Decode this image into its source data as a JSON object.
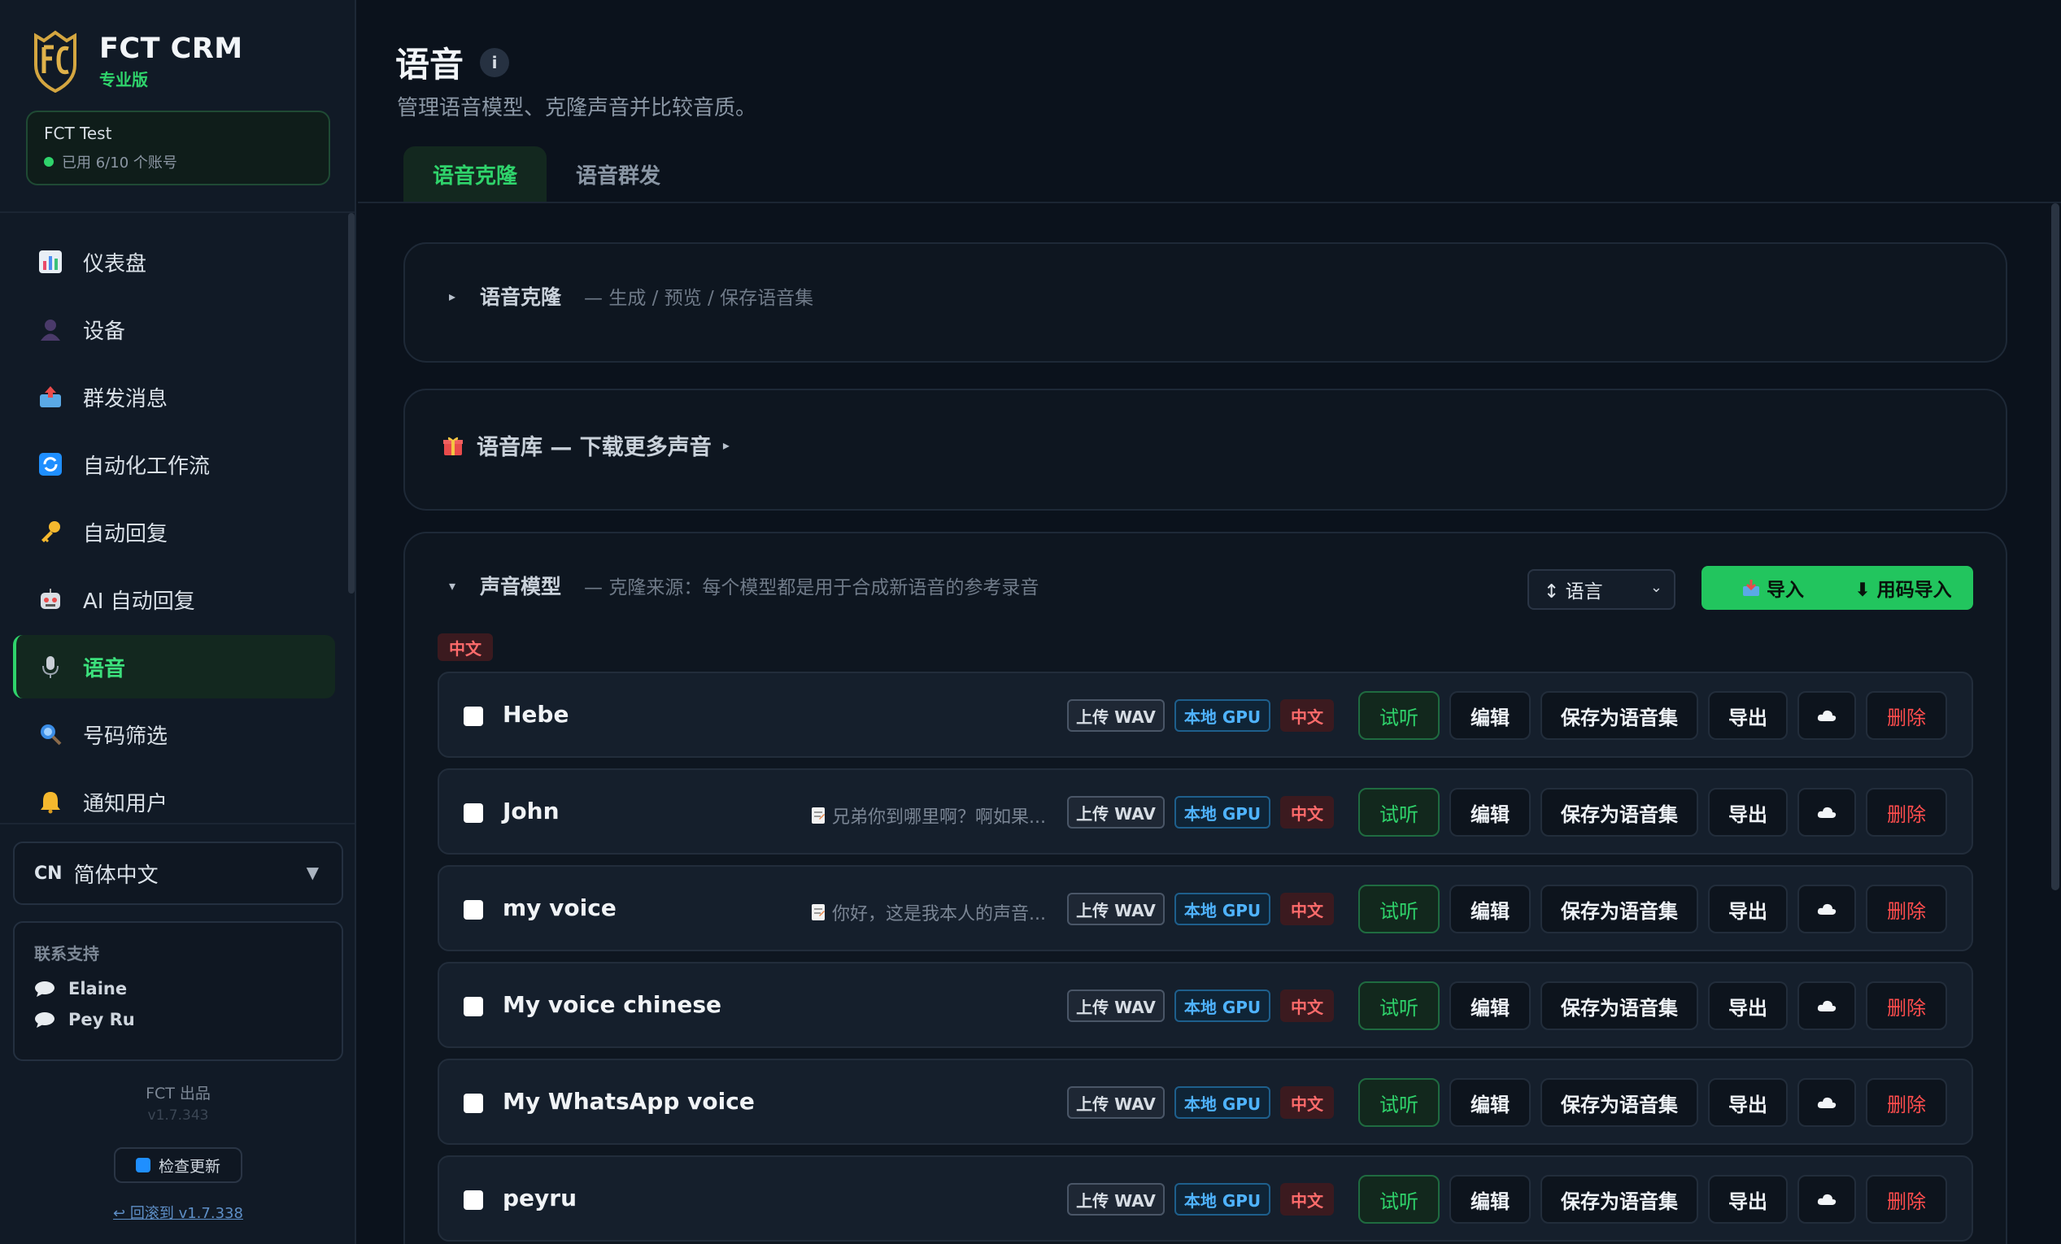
{
  "brand": {
    "name": "FCT CRM",
    "edition": "专业版"
  },
  "account": {
    "name": "FCT Test",
    "usage": "已用 6/10 个账号"
  },
  "nav": [
    {
      "label": "仪表盘",
      "icon": "bar-chart-icon"
    },
    {
      "label": "设备",
      "icon": "user-silhouette-icon"
    },
    {
      "label": "群发消息",
      "icon": "outbox-tray-icon"
    },
    {
      "label": "自动化工作流",
      "icon": "refresh-arrows-icon"
    },
    {
      "label": "自动回复",
      "icon": "key-icon"
    },
    {
      "label": "AI 自动回复",
      "icon": "robot-icon"
    },
    {
      "label": "语音",
      "icon": "microphone-icon",
      "active": true
    },
    {
      "label": "号码筛选",
      "icon": "magnifier-icon"
    },
    {
      "label": "通知用户",
      "icon": "bell-icon"
    }
  ],
  "language": {
    "code": "CN",
    "label": "简体中文"
  },
  "support": {
    "title": "联系支持",
    "contacts": [
      "Elaine",
      "Pey Ru"
    ]
  },
  "footer": {
    "product": "FCT 出品",
    "version": "v1.7.343",
    "update_label": "检查更新",
    "rollback_label": "↩ 回滚到 v1.7.338"
  },
  "page": {
    "title": "语音",
    "info": "i",
    "subtitle": "管理语音模型、克隆声音并比较音质。"
  },
  "tabs": [
    {
      "label": "语音克隆",
      "active": true
    },
    {
      "label": "语音群发",
      "active": false
    }
  ],
  "clone_panel": {
    "title": "语音克隆",
    "subtitle": "— 生成 / 预览 / 保存语音集"
  },
  "library_panel": {
    "title": "语音库 — 下载更多声音",
    "arrow": "▸"
  },
  "models_panel": {
    "title": "声音模型",
    "subtitle": "— 克隆来源：每个模型都是用于合成新语音的参考录音",
    "sort_label": "↕ 语言",
    "import_label": "导入",
    "code_import_label": "⬇ 用码导入",
    "group_label": "中文"
  },
  "row_labels": {
    "upload_wav": "上传 WAV",
    "local_gpu": "本地 GPU",
    "lang": "中文",
    "listen": "试听",
    "edit": "编辑",
    "save_set": "保存为语音集",
    "export": "导出",
    "delete": "删除"
  },
  "models": [
    {
      "name": "Hebe",
      "preview": ""
    },
    {
      "name": "John",
      "preview": "兄弟你到哪里啊？啊如果..."
    },
    {
      "name": "my voice",
      "preview": "你好，这是我本人的声音..."
    },
    {
      "name": "My voice chinese",
      "preview": ""
    },
    {
      "name": "My WhatsApp voice",
      "preview": ""
    },
    {
      "name": "peyru",
      "preview": ""
    }
  ]
}
